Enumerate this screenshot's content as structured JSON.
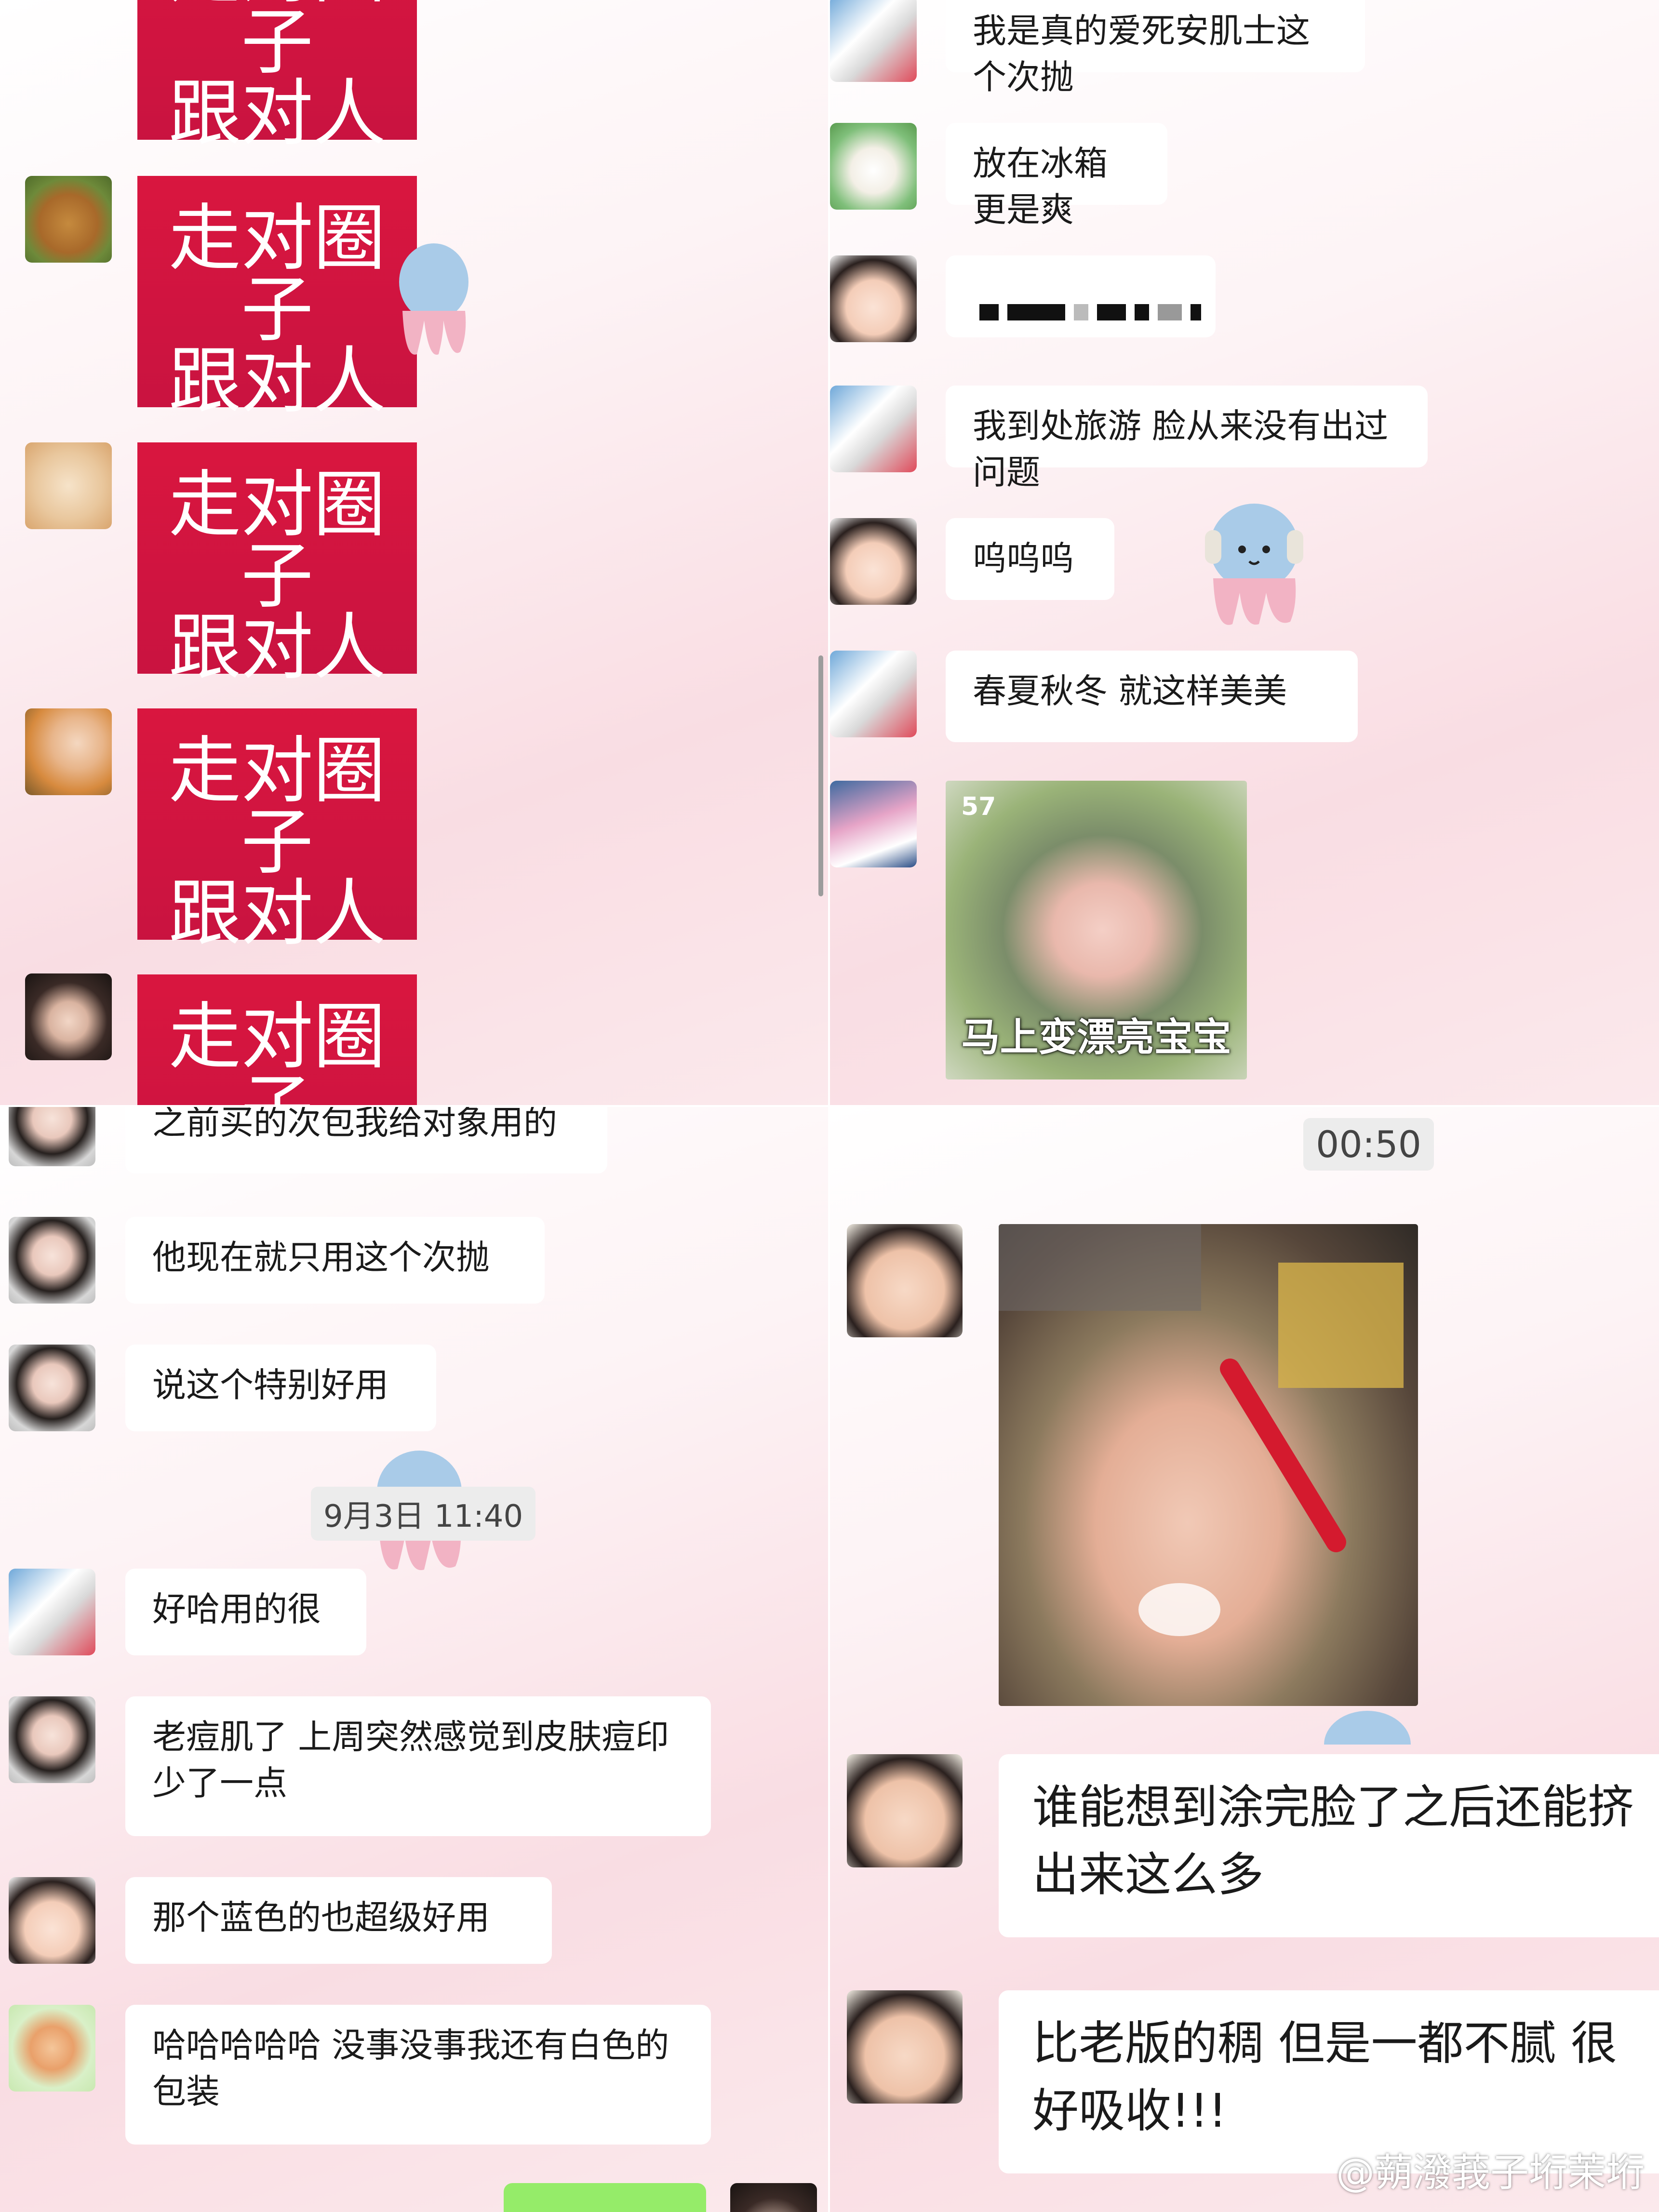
{
  "sticker_text": {
    "line1": "走对圈子",
    "line2": "跟对人"
  },
  "panel_top_right": {
    "messages": [
      "我是真的爱死安肌士这个次抛",
      "放在冰箱更是爽",
      "我到处旅游 脸从来没有出过问题",
      "呜呜呜",
      "春夏秋冬 就这样美美"
    ],
    "image_caption": "马上变漂亮宝宝",
    "image_corner_number": "57"
  },
  "panel_bottom_left": {
    "messages": [
      "之前买的次包我给对象用的",
      "他现在就只用这个次抛",
      "说这个特别好用",
      "好哈用的很",
      "老痘肌了 上周突然感觉到皮肤痘印少了一点",
      "那个蓝色的也超级好用",
      "哈哈哈哈哈 没事没事我还有白色的包装"
    ],
    "timestamp": "9月3日 11:40"
  },
  "panel_bottom_right": {
    "timestamp": "00:50",
    "messages": [
      "谁能想到涂完脸了之后还能挤出来这么多",
      "比老版的稠 但是一都不腻 很好吸收!!!"
    ],
    "watermark": "@蒴潑莪子垳茉垳"
  },
  "colors": {
    "sticker_red": "#d9163f",
    "bubble_white": "#ffffff",
    "background_pink": "#f9dde3",
    "self_bubble_green": "#95ec69"
  }
}
